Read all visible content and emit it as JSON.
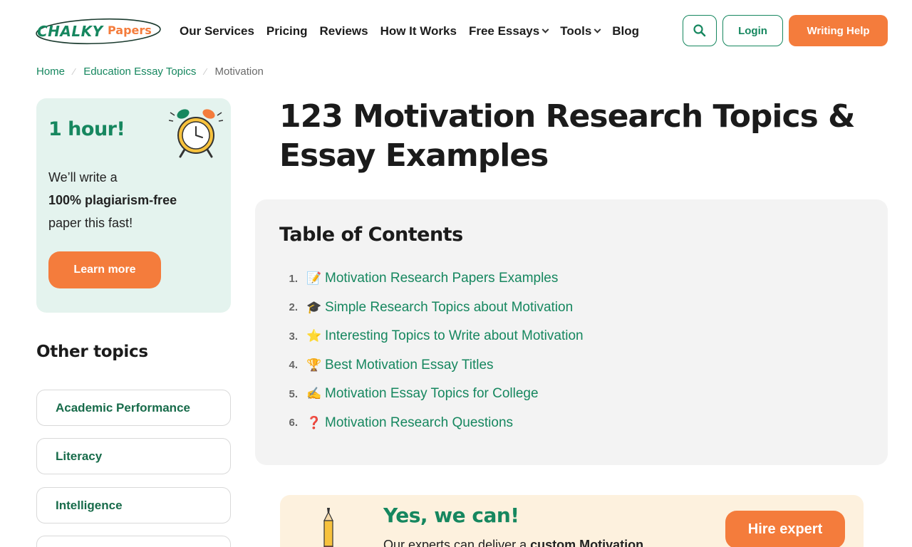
{
  "brand": {
    "logo_part1": "CHALKY",
    "logo_part2": "Papers",
    "green": "#16875f",
    "orange": "#f47c3c"
  },
  "nav": {
    "items": [
      {
        "label": "Our Services",
        "dropdown": false
      },
      {
        "label": "Pricing",
        "dropdown": false
      },
      {
        "label": "Reviews",
        "dropdown": false
      },
      {
        "label": "How It Works",
        "dropdown": false
      },
      {
        "label": "Free Essays",
        "dropdown": true
      },
      {
        "label": "Tools",
        "dropdown": true
      },
      {
        "label": "Blog",
        "dropdown": false
      }
    ],
    "search_icon": "search-icon",
    "login_label": "Login",
    "help_label": "Writing Help"
  },
  "breadcrumb": {
    "items": [
      "Home",
      "Education Essay Topics"
    ],
    "current": "Motivation"
  },
  "promo": {
    "title": "1 hour!",
    "line1": "We’ll write a",
    "line2": "100% plagiarism-free",
    "line3": "paper this fast!",
    "button": "Learn more"
  },
  "other_topics": {
    "title": "Other topics",
    "items": [
      "Academic Performance",
      "Literacy",
      "Intelligence"
    ]
  },
  "main": {
    "title": "123 Motivation Research Topics & Essay Examples"
  },
  "toc": {
    "title": "Table of Contents",
    "items": [
      {
        "num": "1.",
        "icon": "📝",
        "label": "Motivation Research Papers Examples"
      },
      {
        "num": "2.",
        "icon": "🎓",
        "label": "Simple Research Topics about Motivation"
      },
      {
        "num": "3.",
        "icon": "⭐",
        "label": "Interesting Topics to Write about Motivation"
      },
      {
        "num": "4.",
        "icon": "🏆",
        "label": "Best Motivation Essay Titles"
      },
      {
        "num": "5.",
        "icon": "✍️",
        "label": "Motivation Essay Topics for College"
      },
      {
        "num": "6.",
        "icon": "❓",
        "label": "Motivation Research Questions"
      }
    ]
  },
  "hire": {
    "title": "Yes, we can!",
    "text_plain": "Our experts can deliver a ",
    "text_bold": "custom Motivation",
    "button": "Hire expert"
  }
}
